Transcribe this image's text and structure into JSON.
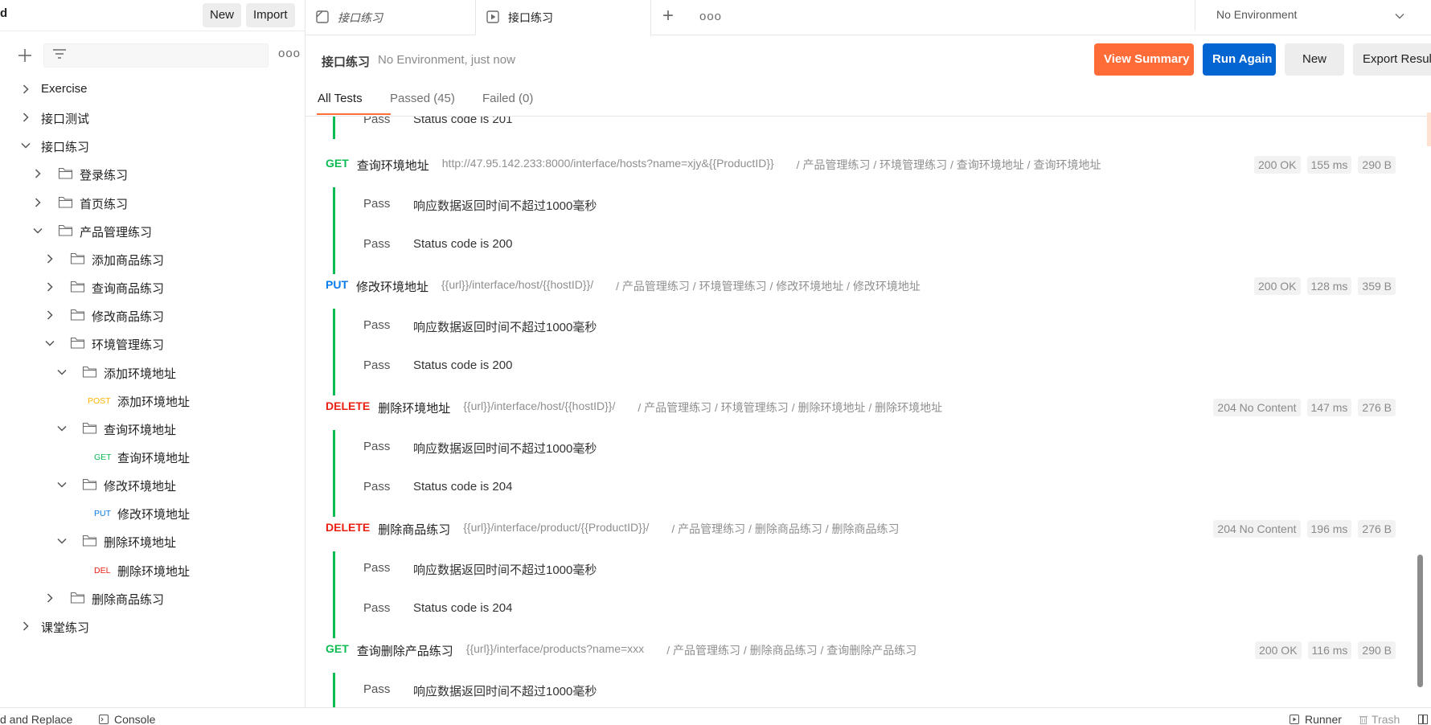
{
  "sidebar": {
    "title": "d",
    "new_label": "New",
    "import_label": "Import",
    "search_placeholder": "",
    "more_label": "ooo",
    "tree": [
      {
        "label": "Exercise"
      },
      {
        "label": "接口测试"
      },
      {
        "label": "接口练习"
      },
      {
        "label": "登录练习"
      },
      {
        "label": "首页练习"
      },
      {
        "label": "产品管理练习"
      },
      {
        "label": "添加商品练习"
      },
      {
        "label": "查询商品练习"
      },
      {
        "label": "修改商品练习"
      },
      {
        "label": "环境管理练习"
      },
      {
        "label": "添加环境地址"
      },
      {
        "label": "添加环境地址",
        "method": "POST"
      },
      {
        "label": "查询环境地址"
      },
      {
        "label": "查询环境地址",
        "method": "GET"
      },
      {
        "label": "修改环境地址"
      },
      {
        "label": "修改环境地址",
        "method": "PUT"
      },
      {
        "label": "删除环境地址"
      },
      {
        "label": "删除环境地址",
        "method": "DEL"
      },
      {
        "label": "删除商品练习"
      },
      {
        "label": "课堂练习"
      }
    ]
  },
  "tabs": [
    {
      "label": "接口练习"
    },
    {
      "label": "接口练习"
    }
  ],
  "tabbar": {
    "add_label": "+",
    "more_label": "ooo"
  },
  "environment": {
    "selected": "No Environment"
  },
  "run": {
    "name": "接口练习",
    "meta": "No Environment, just now",
    "view_summary": "View Summary",
    "run_again": "Run Again",
    "new_label": "New",
    "export_label": "Export Results",
    "tabs": {
      "all": "All Tests",
      "passed": "Passed (45)",
      "failed": "Failed (0)"
    }
  },
  "results": {
    "top_partial": {
      "pass": "Pass",
      "name": "Status code is 201"
    },
    "requests": [
      {
        "method": "GET",
        "method_color": "#0cbb52",
        "name": "查询环境地址",
        "url": "http://47.95.142.233:8000/interface/hosts?name=xjy&{{ProductID}}",
        "path": "/ 产品管理练习 / 环境管理练习 / 查询环境地址 / 查询环境地址",
        "status": "200 OK",
        "time": "155 ms",
        "size": "290 B",
        "tests": [
          {
            "pass": "Pass",
            "name": "响应数据返回时间不超过1000毫秒"
          },
          {
            "pass": "Pass",
            "name": "Status code is 200"
          }
        ]
      },
      {
        "method": "PUT",
        "method_color": "#097bed",
        "name": "修改环境地址",
        "url": "{{url}}/interface/host/{{hostID}}/",
        "path": "/ 产品管理练习 / 环境管理练习 / 修改环境地址 / 修改环境地址",
        "status": "200 OK",
        "time": "128 ms",
        "size": "359 B",
        "tests": [
          {
            "pass": "Pass",
            "name": "响应数据返回时间不超过1000毫秒"
          },
          {
            "pass": "Pass",
            "name": "Status code is 200"
          }
        ]
      },
      {
        "method": "DELETE",
        "method_color": "#eb2013",
        "name": "删除环境地址",
        "url": "{{url}}/interface/host/{{hostID}}/",
        "path": "/ 产品管理练习 / 环境管理练习 / 删除环境地址 / 删除环境地址",
        "status": "204 No Content",
        "time": "147 ms",
        "size": "276 B",
        "tests": [
          {
            "pass": "Pass",
            "name": "响应数据返回时间不超过1000毫秒"
          },
          {
            "pass": "Pass",
            "name": "Status code is 204"
          }
        ]
      },
      {
        "method": "DELETE",
        "method_color": "#eb2013",
        "name": "删除商品练习",
        "url": "{{url}}/interface/product/{{ProductID}}/",
        "path": "/ 产品管理练习 / 删除商品练习 / 删除商品练习",
        "status": "204 No Content",
        "time": "196 ms",
        "size": "276 B",
        "tests": [
          {
            "pass": "Pass",
            "name": "响应数据返回时间不超过1000毫秒"
          },
          {
            "pass": "Pass",
            "name": "Status code is 204"
          }
        ]
      },
      {
        "method": "GET",
        "method_color": "#0cbb52",
        "name": "查询删除产品练习",
        "url": "{{url}}/interface/products?name=xxx",
        "path": "/ 产品管理练习 / 删除商品练习 / 查询删除产品练习",
        "status": "200 OK",
        "time": "116 ms",
        "size": "290 B",
        "tests": [
          {
            "pass": "Pass",
            "name": "响应数据返回时间不超过1000毫秒"
          }
        ]
      }
    ]
  },
  "footer": {
    "find_replace": "d and Replace",
    "console": "Console",
    "runner": "Runner",
    "trash": "Trash"
  },
  "colors": {
    "accent_orange": "#ff6c37",
    "primary_blue": "#0265d2",
    "pass_green": "#0cbb52",
    "post_color": "#ffb400",
    "get_color": "#0cbb52",
    "put_color": "#097bed",
    "delete_color": "#eb2013"
  },
  "icons": [
    "plus-icon",
    "filter-icon",
    "chevron-right-icon",
    "chevron-down-icon",
    "folder-icon",
    "collection-icon",
    "runner-icon",
    "console-icon",
    "trash-icon",
    "layout-icon"
  ]
}
